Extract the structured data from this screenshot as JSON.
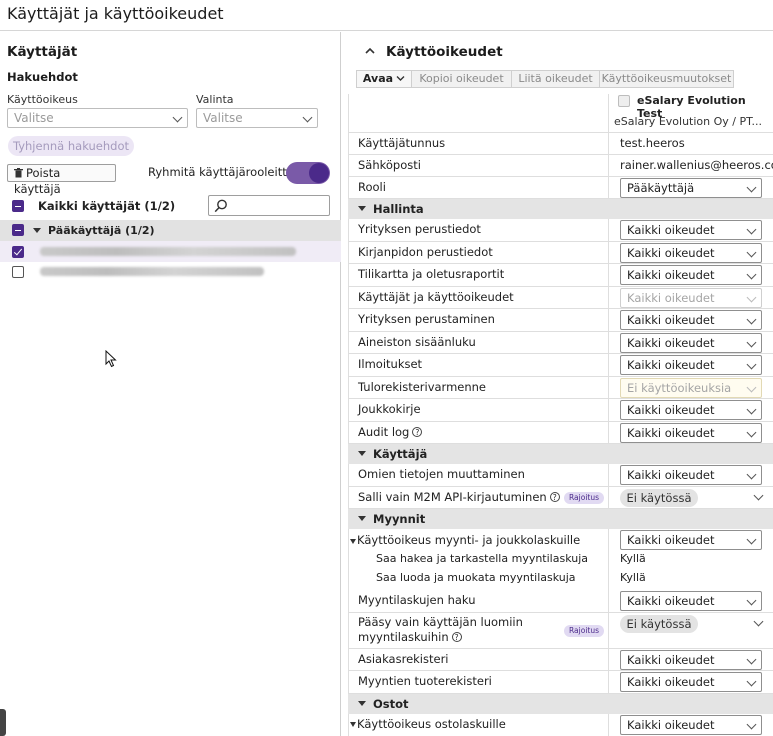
{
  "page_title": "Käyttäjät ja käyttöoikeudet",
  "users": {
    "title": "Käyttäjät",
    "search_title": "Hakuehdot",
    "role_label": "Käyttöoikeus",
    "role_placeholder": "Valitse",
    "choice_label": "Valinta",
    "choice_placeholder": "Valitse",
    "clear_button": "Tyhjennä hakuehdot",
    "delete_button": "Poista käyttäjä",
    "group_toggle_label": "Ryhmitä käyttäjärooleittain",
    "group_toggle_on": true,
    "all_users_label": "Kaikki käyttäjät (1/2)",
    "role_group_label": "Pääkäyttäjä (1/2)"
  },
  "permissions": {
    "title": "Käyttöoikeudet",
    "tabs": [
      "Avaa",
      "Kopioi oikeudet",
      "Liitä oikeudet",
      "Käyttöoikeusmuutokset"
    ],
    "company_name": "eSalary Evolution Test",
    "company_sub": "eSalary Evolution Oy / PT...",
    "info_rows": [
      {
        "label": "Käyttäjätunnus",
        "value": "test.heeros"
      },
      {
        "label": "Sähköposti",
        "value": "rainer.wallenius@heeros.com"
      },
      {
        "label": "Rooli",
        "value": "Pääkäyttäjä"
      }
    ],
    "groups": {
      "hallinta": "Hallinta",
      "kayttaja": "Käyttäjä",
      "myynnit": "Myynnit",
      "ostot": "Ostot"
    },
    "hallinta_rows": [
      {
        "label": "Yrityksen perustiedot",
        "value": "Kaikki oikeudet"
      },
      {
        "label": "Kirjanpidon perustiedot",
        "value": "Kaikki oikeudet"
      },
      {
        "label": "Tilikartta ja oletusraportit",
        "value": "Kaikki oikeudet"
      },
      {
        "label": "Käyttäjät ja käyttöoikeudet",
        "value": "Kaikki oikeudet"
      },
      {
        "label": "Yrityksen perustaminen",
        "value": "Kaikki oikeudet"
      },
      {
        "label": "Aineiston sisäänluku",
        "value": "Kaikki oikeudet"
      },
      {
        "label": "Ilmoitukset",
        "value": "Kaikki oikeudet"
      },
      {
        "label": "Tulorekisterivarmenne",
        "value": "Ei käyttöoikeuksia"
      },
      {
        "label": "Joukkokirje",
        "value": "Kaikki oikeudet"
      },
      {
        "label": "Audit log",
        "value": "Kaikki oikeudet"
      }
    ],
    "kayttaja_rows": [
      {
        "label": "Omien tietojen muuttaminen",
        "value": "Kaikki oikeudet"
      },
      {
        "label": "Salli vain M2M API-kirjautuminen",
        "badge": "Rajoitus",
        "value": "Ei käytössä"
      }
    ],
    "myynnit_rows": [
      {
        "label": "Käyttöoikeus myynti- ja joukkolaskuille",
        "value": "Kaikki oikeudet"
      },
      {
        "label": "Saa hakea ja tarkastella myyntilaskuja",
        "value": "Kyllä"
      },
      {
        "label": "Saa luoda ja muokata myyntilaskuja",
        "value": "Kyllä"
      },
      {
        "label": "Myyntilaskujen haku",
        "value": "Kaikki oikeudet"
      },
      {
        "label1": "Pääsy vain käyttäjän luomiin",
        "label2": "myyntilaskuihin",
        "badge": "Rajoitus",
        "value": "Ei käytössä"
      },
      {
        "label": "Asiakasrekisteri",
        "value": "Kaikki oikeudet"
      },
      {
        "label": "Myyntien tuoterekisteri",
        "value": "Kaikki oikeudet"
      }
    ],
    "ostot_rows": [
      {
        "label": "Käyttöoikeus ostolaskuille",
        "value": "Kaikki oikeudet"
      }
    ]
  },
  "icons": {
    "collapse": "chevron-up-icon",
    "delete": "trash-icon",
    "search": "search-icon",
    "dropdown": "chevron-down-icon",
    "help": "question-circle-icon",
    "cursor": "mouse-pointer-icon"
  },
  "colors": {
    "accent": "#4b2a8a",
    "toggle_track": "#7a5aa8",
    "group_bg": "#e4e4e4",
    "badge_bg": "#e1daf2"
  }
}
